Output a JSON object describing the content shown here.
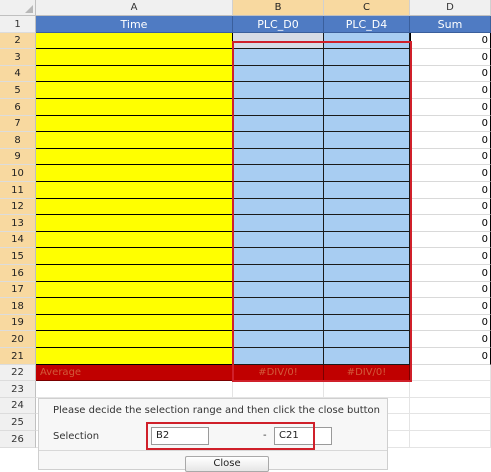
{
  "columns": [
    {
      "letter": "A"
    },
    {
      "letter": "B"
    },
    {
      "letter": "C"
    },
    {
      "letter": "D"
    }
  ],
  "header_row": {
    "time": "Time",
    "plc_d0": "PLC_D0",
    "plc_d4": "PLC_D4",
    "sum": "Sum"
  },
  "rows": [
    {
      "num": "1"
    },
    {
      "num": "2",
      "sum": "0"
    },
    {
      "num": "3",
      "sum": "0"
    },
    {
      "num": "4",
      "sum": "0"
    },
    {
      "num": "5",
      "sum": "0"
    },
    {
      "num": "6",
      "sum": "0"
    },
    {
      "num": "7",
      "sum": "0"
    },
    {
      "num": "8",
      "sum": "0"
    },
    {
      "num": "9",
      "sum": "0"
    },
    {
      "num": "10",
      "sum": "0"
    },
    {
      "num": "11",
      "sum": "0"
    },
    {
      "num": "12",
      "sum": "0"
    },
    {
      "num": "13",
      "sum": "0"
    },
    {
      "num": "14",
      "sum": "0"
    },
    {
      "num": "15",
      "sum": "0"
    },
    {
      "num": "16",
      "sum": "0"
    },
    {
      "num": "17",
      "sum": "0"
    },
    {
      "num": "18",
      "sum": "0"
    },
    {
      "num": "19",
      "sum": "0"
    },
    {
      "num": "20",
      "sum": "0"
    },
    {
      "num": "21",
      "sum": "0"
    },
    {
      "num": "22"
    },
    {
      "num": "23"
    },
    {
      "num": "24"
    },
    {
      "num": "25"
    },
    {
      "num": "26"
    }
  ],
  "average_row": {
    "label": "Average",
    "b": "#DIV/0!",
    "c": "#DIV/0!"
  },
  "dialog": {
    "message": "Please decide the selection range and then click the close button",
    "selection_label": "Selection",
    "from_value": "B2",
    "separator": "-",
    "to_value": "C21",
    "close_label": "Close"
  },
  "colors": {
    "header_blue": "#4f7bc3",
    "time_yellow": "#ffff00",
    "selection_blue": "#a8cdf2",
    "average_red": "#c00000",
    "highlight_red": "#d0202a"
  }
}
